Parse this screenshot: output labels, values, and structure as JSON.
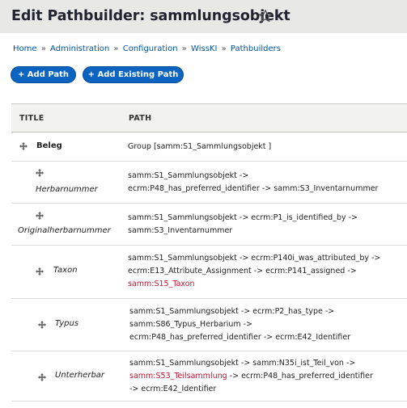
{
  "page": {
    "title": "Edit Pathbuilder: sammlungsobjekt",
    "star_icon": "star-outline-icon"
  },
  "breadcrumb": {
    "items": [
      "Home",
      "Administration",
      "Configuration",
      "WissKI",
      "Pathbuilders"
    ],
    "separator": "»"
  },
  "actions": {
    "add_path": "+ Add Path",
    "add_existing_path": "+ Add Existing Path"
  },
  "table": {
    "headers": {
      "title": "TITLE",
      "path": "PATH"
    },
    "rows": [
      {
        "title": "Beleg",
        "lines": [
          "Group [samm:S1_Sammlungsobjekt ]"
        ]
      },
      {
        "title": "Herbarnummer",
        "lines": [
          "samm:S1_Sammlungsobjekt ->",
          "ecrm:P48_has_preferred_identifier -> samm:S3_Inventarnummer"
        ]
      },
      {
        "title": "Originalherbarnummer",
        "lines": [
          "samm:S1_Sammlungsobjekt -> ecrm:P1_is_identified_by ->",
          "samm:S3_Inventarnummer"
        ]
      },
      {
        "title": "Taxon",
        "lines": [
          "samm:S1_Sammlungsobjekt -> ecrm:P140i_was_attributed_by ->",
          "ecrm:E13_Attribute_Assignment -> ecrm:P141_assigned ->"
        ],
        "highlight": "samm:S15_Taxon"
      },
      {
        "title": "Typus",
        "lines": [
          "samm:S1_Sammlungsobjekt -> ecrm:P2_has_type ->",
          "samm:S86_Typus_Herbarium ->",
          "ecrm:P48_has_preferred_identifier -> ecrm:E42_Identifier"
        ]
      },
      {
        "title": "Unterherbar",
        "line1": "samm:S1_Sammlungsobjekt -> samm:N35i_ist_Teil_von ->",
        "line2_highlight": "samm:S53_Teilsammlung",
        "line2_rest": " -> ecrm:P48_has_preferred_identifier",
        "line3": "-> ecrm:E42_Identifier"
      }
    ]
  },
  "colors": {
    "header_bg": "#e8e8e6",
    "link": "#0054a5",
    "button": "#0a64c0",
    "highlight": "#c8102e"
  }
}
